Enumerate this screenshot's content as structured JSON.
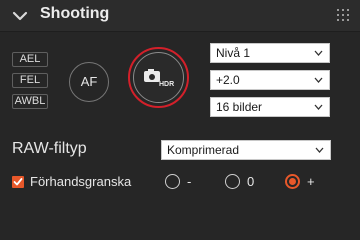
{
  "header": {
    "title": "Shooting",
    "collapse_icon": "chevron-down-icon",
    "grip_icon": "grip-dots-icon"
  },
  "bracketing": {
    "ael_label": "AEL",
    "fel_label": "FEL",
    "awbl_label": "AWBL",
    "af_label": "AF",
    "hdr_button": {
      "icon": "hdr-camera-icon",
      "icon_text": "HDR",
      "active_ring_color": "#d3202a"
    }
  },
  "hdr_settings": {
    "level": {
      "value": "Nivå 1"
    },
    "ev": {
      "value": "+2.0"
    },
    "frames": {
      "value": "16 bilder"
    }
  },
  "raw": {
    "label": "RAW-filtyp",
    "value": "Komprimerad"
  },
  "preview": {
    "checkbox_label": "Förhandsgranska",
    "checked": true,
    "options": [
      {
        "label": "-",
        "selected": false
      },
      {
        "label": "0",
        "selected": false
      },
      {
        "label": "+",
        "selected": true
      }
    ],
    "accent_color": "#e8582a"
  }
}
